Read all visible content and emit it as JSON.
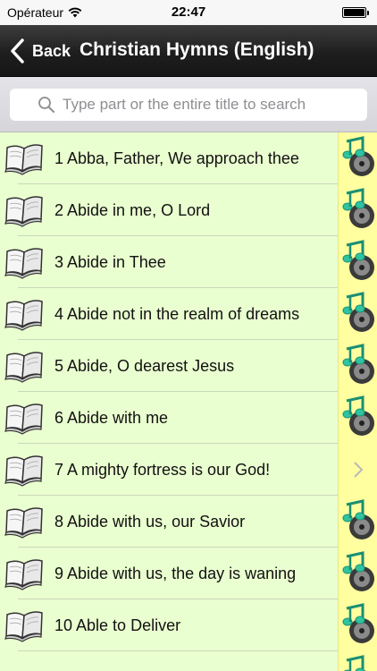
{
  "status_bar": {
    "carrier": "Opérateur",
    "time": "22:47"
  },
  "nav": {
    "back_label": "Back",
    "title": "Christian Hymns (English)"
  },
  "search": {
    "placeholder": "Type part or the entire title to search"
  },
  "list": {
    "items": [
      {
        "title": "1 Abba, Father, We approach thee",
        "accessory": "music-disc-icon"
      },
      {
        "title": "2 Abide in me, O Lord",
        "accessory": "music-disc-icon"
      },
      {
        "title": "3 Abide in Thee",
        "accessory": "music-disc-icon"
      },
      {
        "title": "4 Abide not in the realm of dreams",
        "accessory": "music-disc-icon"
      },
      {
        "title": "5 Abide, O dearest Jesus",
        "accessory": "music-disc-icon"
      },
      {
        "title": "6 Abide with me",
        "accessory": "music-disc-icon"
      },
      {
        "title": "7 A mighty fortress is our God!",
        "accessory": "chevron-right-icon"
      },
      {
        "title": "8 Abide with us, our Savior",
        "accessory": "music-disc-icon"
      },
      {
        "title": "9 Abide with us, the day is waning",
        "accessory": "music-disc-icon"
      },
      {
        "title": "10 Able to Deliver",
        "accessory": "music-disc-icon"
      },
      {
        "title": "",
        "accessory": "music-disc-icon"
      }
    ]
  },
  "colors": {
    "row_background": "#eaffd0",
    "accessory_background": "#ffffa0",
    "nav_background": "#1e1e1e",
    "music_note": "#2ec4a0"
  }
}
